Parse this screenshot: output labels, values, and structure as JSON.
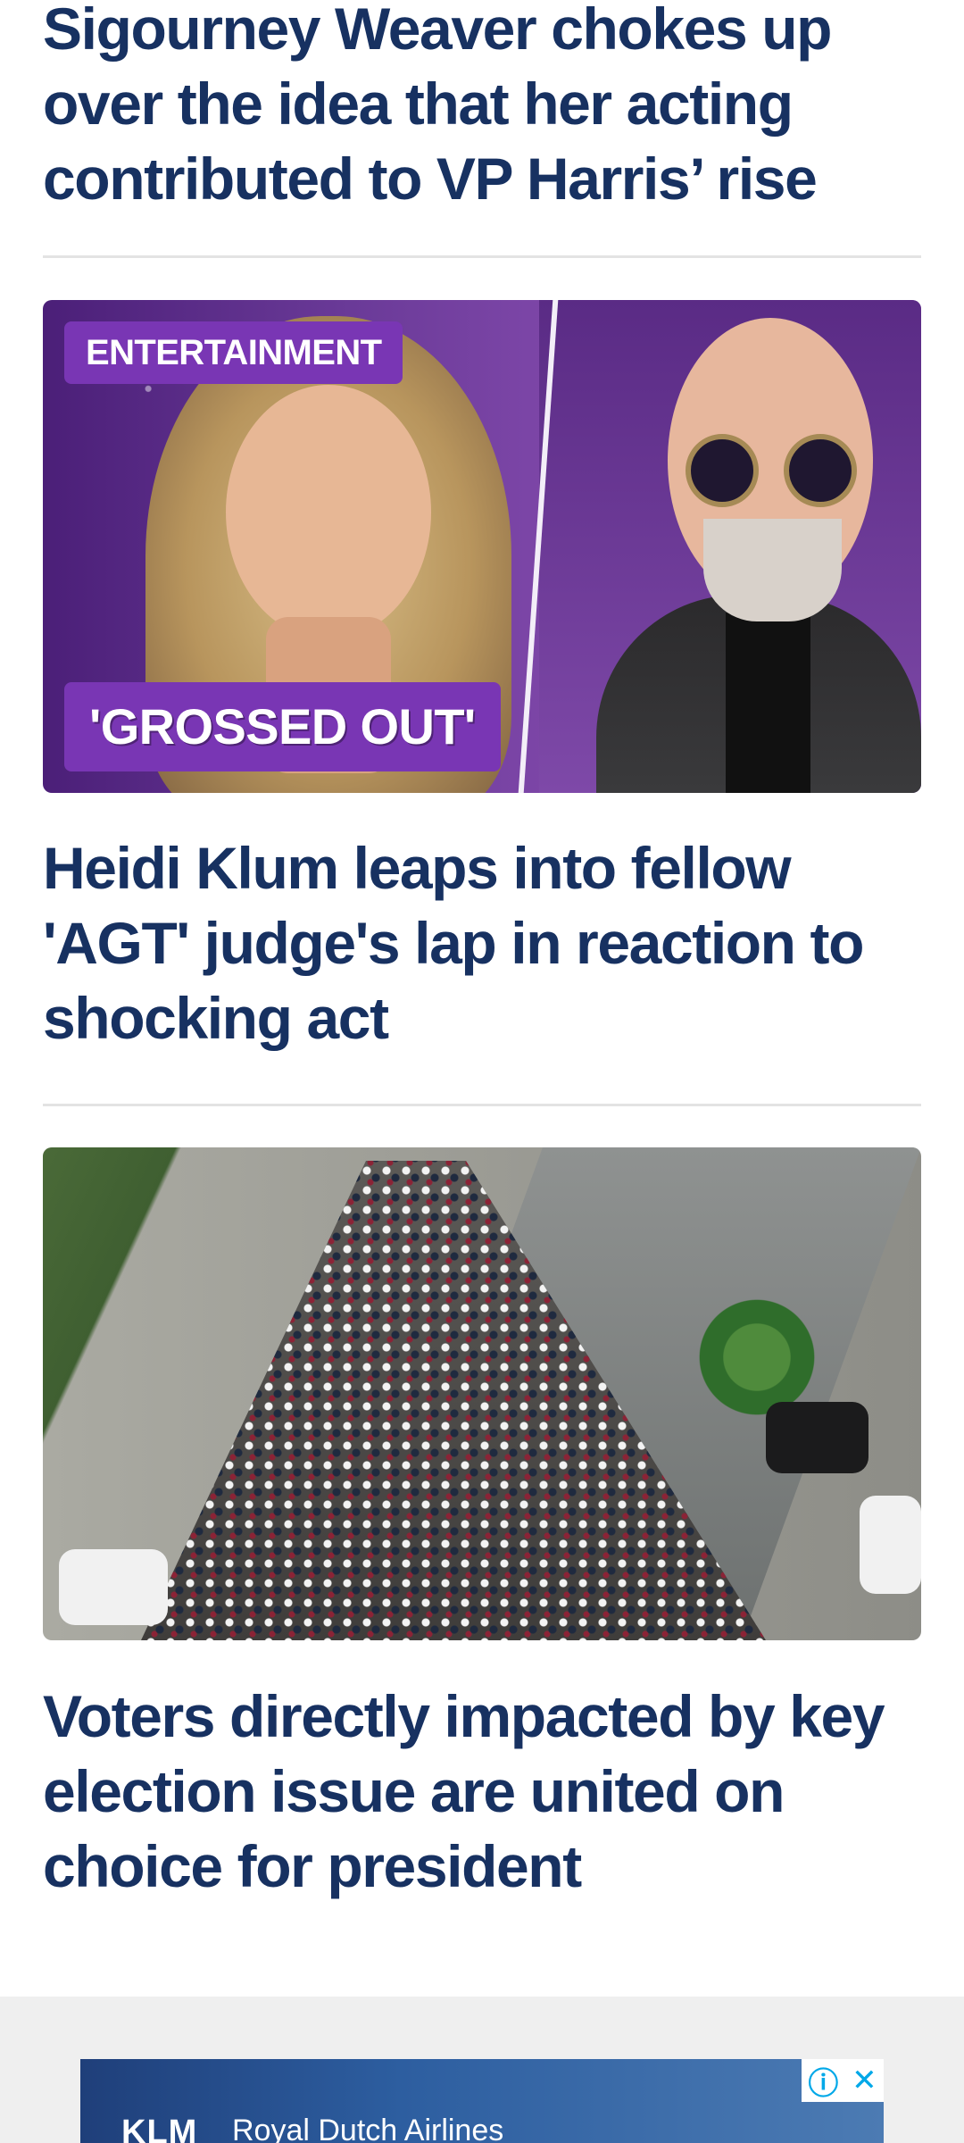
{
  "stories": [
    {
      "headline": "Sigourney Weaver chokes up over the idea that her acting contributed to VP Harris’ rise"
    },
    {
      "category": "ENTERTAINMENT",
      "overlay": "'GROSSED OUT'",
      "headline": "Heidi Klum leaps into fellow 'AGT' judge's lap in reaction to shocking act"
    },
    {
      "headline": "Voters directly impacted by key election issue are united on choice for president"
    }
  ],
  "ad": {
    "logo": "KLM",
    "text": "Royal Dutch Airlines",
    "info_icon": "info-icon",
    "close_icon": "close-icon",
    "info_glyph": "ⓘ",
    "close_glyph": "✕"
  }
}
